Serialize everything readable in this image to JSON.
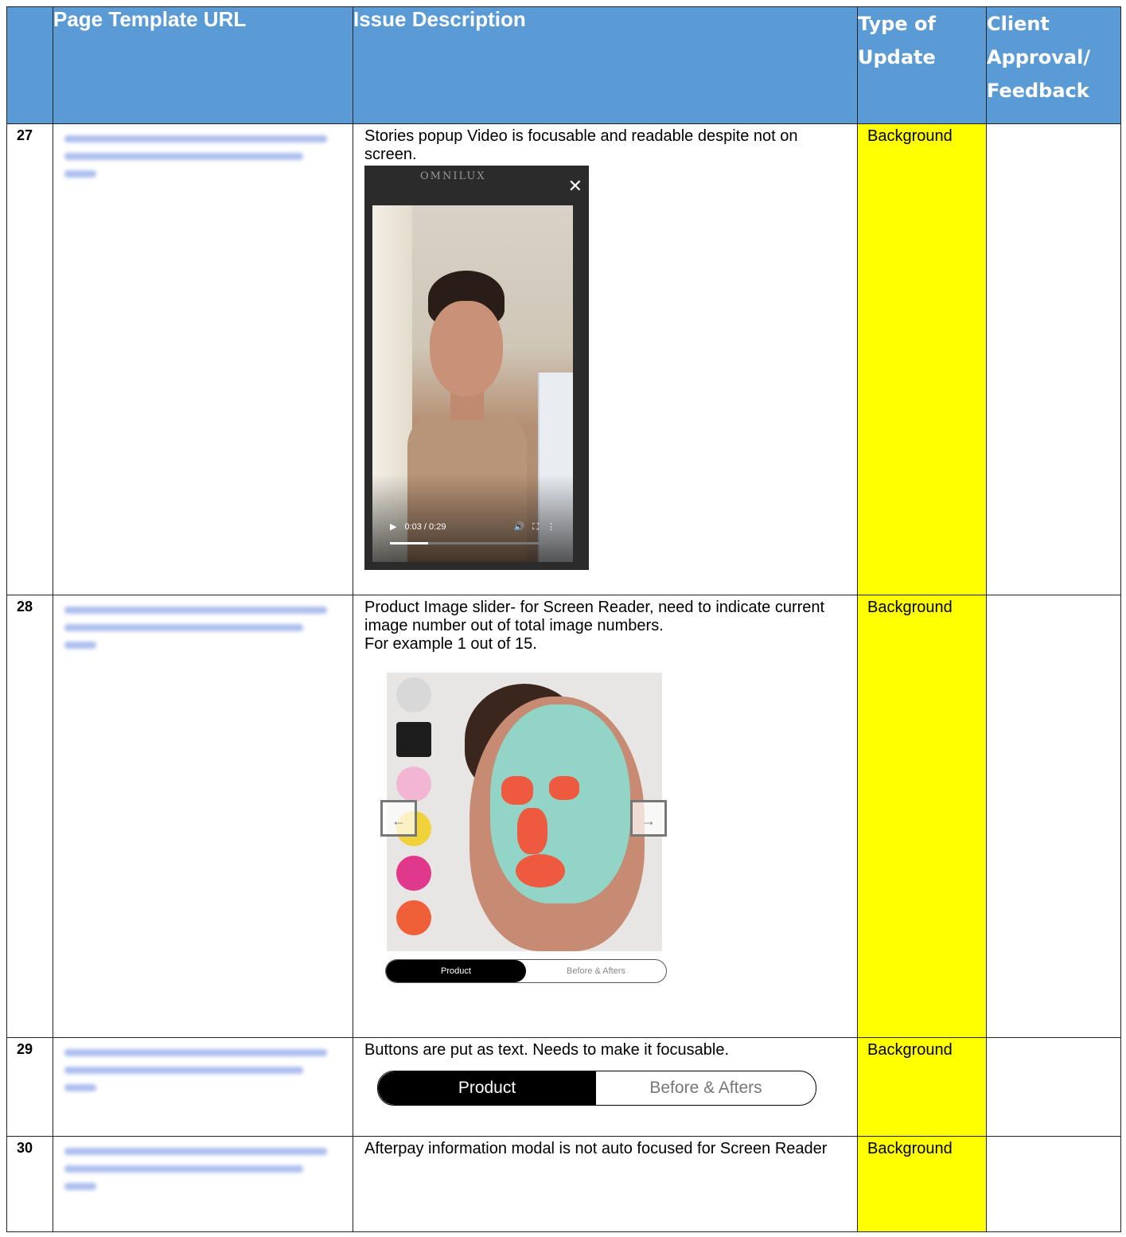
{
  "headers": {
    "url": "Page Template URL",
    "description": "Issue Description",
    "type_line1": "Type of",
    "type_line2": "Update",
    "client_line1": "Client",
    "client_line2": "Approval/",
    "client_line3": "Feedback"
  },
  "rows": [
    {
      "num": "27",
      "description": "Stories popup Video is focusable and readable despite not on screen.",
      "type": "Background",
      "video": {
        "brand": "OMNILUX",
        "time": "0:03 / 0:29"
      }
    },
    {
      "num": "28",
      "description_lines": [
        "Product Image slider- for Screen Reader, need to indicate current image number out of total image numbers.",
        "For example 1 out of 15."
      ],
      "type": "Background",
      "tabs": {
        "active": "Product",
        "inactive": "Before & Afters"
      }
    },
    {
      "num": "29",
      "description": "Buttons are put as text. Needs to make it focusable.",
      "type": "Background",
      "tabs": {
        "active": "Product",
        "inactive": "Before & Afters"
      }
    },
    {
      "num": "30",
      "description": "Afterpay information modal is not auto focused for Screen Reader",
      "type": "Background"
    }
  ],
  "colors": {
    "header_bg": "#5b9bd5",
    "highlight": "#ffff00",
    "link_blur": "#4a6fd8"
  },
  "icons": [
    "close-icon",
    "play-icon",
    "volume-icon",
    "fullscreen-icon",
    "more-vertical-icon",
    "arrow-left-icon",
    "arrow-right-icon"
  ]
}
